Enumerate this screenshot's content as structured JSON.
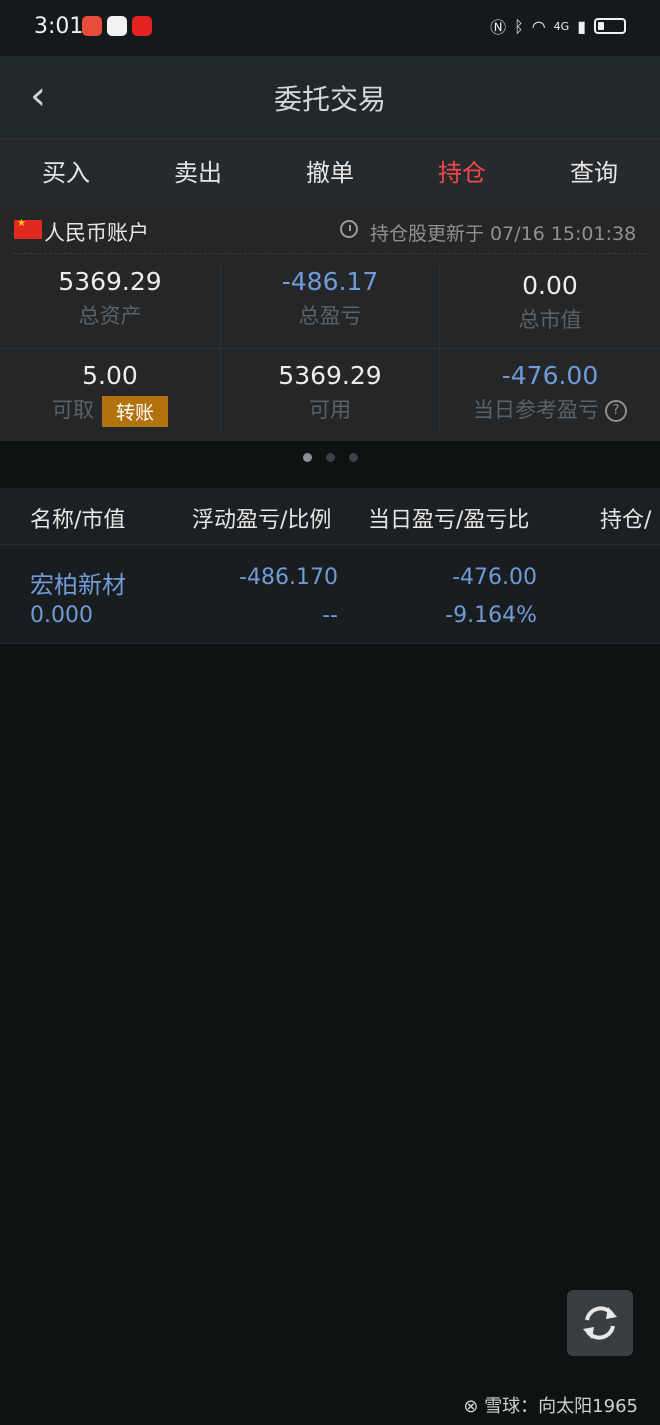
{
  "status": {
    "time": "3:01",
    "network": "4G",
    "app_badge_colors": [
      "#e74c3c",
      "#f2f2f2",
      "#e32222"
    ]
  },
  "nav": {
    "back_icon": "chevron-left-icon",
    "title": "委托交易"
  },
  "tabs": [
    {
      "label": "买入"
    },
    {
      "label": "卖出"
    },
    {
      "label": "撤单"
    },
    {
      "label": "持仓"
    },
    {
      "label": "查询"
    }
  ],
  "active_tab": "持仓",
  "account": {
    "name": "人民币账户",
    "update_text": "持仓股更新于 07/16 15:01:38",
    "stats": {
      "total_assets": {
        "value": "5369.29",
        "label": "总资产"
      },
      "total_pl": {
        "value": "-486.17",
        "label": "总盈亏"
      },
      "market_value": {
        "value": "0.00",
        "label": "总市值"
      },
      "withdrawable": {
        "value": "5.00",
        "label": "可取"
      },
      "available": {
        "value": "5369.29",
        "label": "可用"
      },
      "daily_pl": {
        "value": "-476.00",
        "label": "当日参考盈亏"
      }
    },
    "transfer_label": "转账",
    "help_icon": "question-circle-icon"
  },
  "pager": {
    "total": 3,
    "active": 1
  },
  "positions": {
    "columns": [
      "名称/市值",
      "浮动盈亏/比例",
      "当日盈亏/盈亏比",
      "持仓/"
    ],
    "rows": [
      {
        "name": "宏柏新材",
        "market_value": "0.000",
        "float_pl": "-486.170",
        "float_ratio": "--",
        "daily_pl": "-476.00",
        "daily_ratio": "-9.164%"
      }
    ]
  },
  "refresh_icon": "refresh-icon",
  "watermark": "雪球：向太阳1965",
  "colors": {
    "accent_red": "#f14a4a",
    "loss_blue": "#6f9bd8",
    "transfer_gold": "#b2720e"
  }
}
